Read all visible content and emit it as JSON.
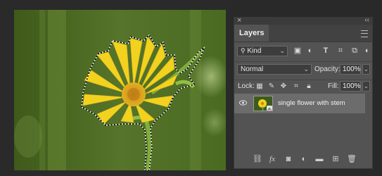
{
  "canvas": {
    "description_icon": "image-canvas"
  },
  "panel": {
    "close_glyph": "×",
    "collapse_glyph": "‹‹",
    "tab_label": "Layers",
    "filter": {
      "kind_label": "Kind",
      "icons": [
        "image-filter-icon",
        "adjustment-filter-icon",
        "type-filter-icon",
        "shape-filter-icon",
        "smart-object-filter-icon"
      ]
    },
    "blend_mode": "Normal",
    "opacity_label": "Opacity:",
    "opacity_value": "100%",
    "lock_label": "Lock:",
    "fill_label": "Fill:",
    "fill_value": "100%",
    "layers": [
      {
        "name": "single flower with stem",
        "visible": true,
        "selected": true
      }
    ],
    "bottom_icons": [
      "link-layers-icon",
      "fx-icon",
      "mask-icon",
      "adjustment-icon",
      "folder-icon",
      "new-layer-icon",
      "trash-icon"
    ]
  },
  "colors": {
    "panel_bg": "#535353",
    "selected_row": "#6c6c6c",
    "flower_yellow": "#f2d21f",
    "background_green": "#4d6a26"
  }
}
